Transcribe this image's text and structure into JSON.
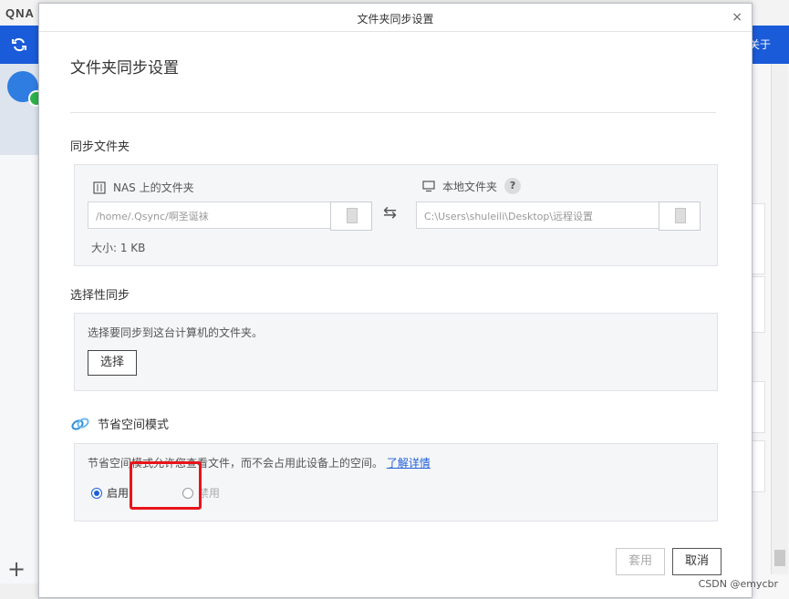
{
  "background": {
    "logo": "QNA",
    "right_top_label": "关于",
    "add_symbol": "+",
    "watermark": "CSDN @emycbr"
  },
  "dialog": {
    "window_title": "文件夹同步设置",
    "close_symbol": "×",
    "heading": "文件夹同步设置",
    "sync_folder": {
      "title": "同步文件夹",
      "nas_label": "NAS 上的文件夹",
      "nas_path": "/home/.Qsync/啊圣诞袜",
      "local_label": "本地文件夹",
      "local_path": "C:\\Users\\shuleili\\Desktop\\远程设置",
      "help_symbol": "?",
      "swap_symbol": "⇆",
      "size_text": "大小: 1 KB"
    },
    "selective_sync": {
      "title": "选择性同步",
      "hint": "选择要同步到这台计算机的文件夹。",
      "select_button": "选择"
    },
    "space_saving": {
      "title": "节省空间模式",
      "description": "节省空间模式允许您查看文件，而不会占用此设备上的空间。",
      "learn_more": "了解详情",
      "option_enable": "启用",
      "option_disable": "禁用",
      "selected": "启用"
    },
    "footer": {
      "apply_button": "套用",
      "cancel_button": "取消"
    }
  },
  "colors": {
    "brand_blue": "#1a5bd9",
    "link_blue": "#1e5fd6",
    "highlight_red": "#e8141a"
  }
}
